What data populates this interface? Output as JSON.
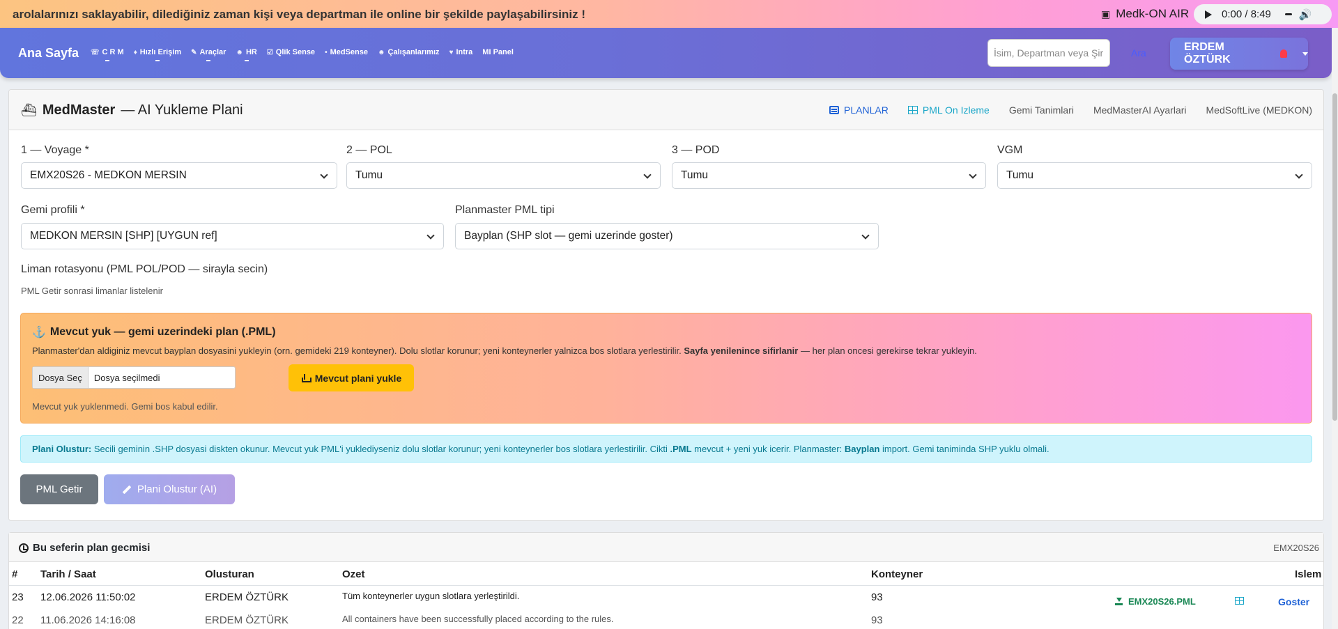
{
  "marquee": {
    "text": "arolalarınızı saklayabilir, dilediğiniz zaman kişi veya departman ile online bir şekilde paylaşabilirsiniz !"
  },
  "radio": {
    "label": "Medk-ON AIR",
    "time": "0:00 / 8:49"
  },
  "navbar": {
    "brand": "Ana Sayfa",
    "items": [
      {
        "label": "C R M",
        "icon": "crm-icon",
        "glyph": "☏"
      },
      {
        "label": "Hızlı Erişim",
        "icon": "rocket-icon",
        "glyph": "♦"
      },
      {
        "label": "Araçlar",
        "icon": "tools-icon",
        "glyph": "✎"
      },
      {
        "label": "HR",
        "icon": "people-icon",
        "glyph": "☻"
      },
      {
        "label": "Qlik Sense",
        "icon": "checkbox-icon",
        "glyph": "☑"
      },
      {
        "label": "MedSense",
        "icon": "pin-icon",
        "glyph": "•"
      },
      {
        "label": "Çalışanlarımız",
        "icon": "people-icon",
        "glyph": "☻"
      },
      {
        "label": "Intra",
        "icon": "handshake-icon",
        "glyph": "♥"
      },
      {
        "label": "MI Panel",
        "icon": "",
        "glyph": ""
      }
    ],
    "search_placeholder": "İsim, Departman veya Şirket",
    "search_button": "Ara",
    "user": "ERDEM ÖZTÜRK"
  },
  "card": {
    "title_bold": "MedMaster",
    "title_rest": "— AI Yukleme Plani",
    "tabs": [
      {
        "label": "PLANLAR",
        "state": "active"
      },
      {
        "label": "PML On Izleme",
        "state": "cyan"
      },
      {
        "label": "Gemi Tanimlari",
        "state": ""
      },
      {
        "label": "MedMasterAI Ayarlari",
        "state": ""
      },
      {
        "label": "MedSoftLive (MEDKON)",
        "state": ""
      }
    ],
    "voyage": {
      "label": "1 — Voyage *",
      "value": "EMX20S26 - MEDKON MERSIN"
    },
    "pol": {
      "label": "2 — POL",
      "value": "Tumu"
    },
    "pod": {
      "label": "3 — POD",
      "value": "Tumu"
    },
    "vgm": {
      "label": "VGM",
      "value": "Tumu"
    },
    "profile": {
      "label": "Gemi profili *",
      "value": "MEDKON MERSIN [SHP] [UYGUN ref]"
    },
    "pml_type": {
      "label": "Planmaster PML tipi",
      "value": "Bayplan (SHP slot — gemi uzerinde goster)"
    },
    "rotation": {
      "label": "Liman rotasyonu (PML POL/POD — sirayla secin)",
      "hint": "PML Getir sonrasi limanlar listelenir"
    },
    "upload": {
      "title": "Mevcut yuk — gemi uzerindeki plan (.PML)",
      "desc_pre": "Planmaster'dan aldiginiz mevcut bayplan dosyasini yukleyin (orn. gemideki 219 konteyner). Dolu slotlar korunur; yeni konteynerler yalnizca bos slotlara yerlestirilir. ",
      "desc_bold": "Sayfa yenilenince sifirlanir",
      "desc_post": " — her plan oncesi gerekirse tekrar yukleyin.",
      "file_button": "Dosya Seç",
      "file_name": "Dosya seçilmedi",
      "load_button": "Mevcut plani yukle",
      "status": "Mevcut yuk yuklenmedi. Gemi bos kabul edilir."
    },
    "info": {
      "b1": "Plani Olustur:",
      "t1": " Secili geminin .SHP dosyasi diskten okunur. Mevcut yuk PML'i yuklediyseniz dolu slotlar korunur; yeni konteynerler bos slotlara yerlestirilir. Cikti ",
      "b2": ".PML",
      "t2": " mevcut + yeni yuk icerir. Planmaster: ",
      "b3": "Bayplan",
      "t3": " import. Gemi taniminda SHP yuklu olmali."
    },
    "btn_getir": "PML Getir",
    "btn_olustur": "Plani Olustur (AI)"
  },
  "history": {
    "title": "Bu seferin plan gecmisi",
    "voyage": "EMX20S26",
    "headers": {
      "no": "#",
      "date": "Tarih / Saat",
      "creator": "Olusturan",
      "summary": "Ozet",
      "count": "Konteyner",
      "action": "Islem"
    },
    "rows": [
      {
        "no": "23",
        "date": "12.06.2026 11:50:02",
        "creator": "ERDEM ÖZTÜRK",
        "summary": "Tüm konteynerler uygun slotlara yerleştirildi.",
        "count": "93",
        "file": "EMX20S26.PML",
        "show": "Goster"
      },
      {
        "no": "22",
        "date": "11.06.2026 14:16:08",
        "creator": "ERDEM ÖZTÜRK",
        "summary": "All containers have been successfully placed according to the rules.",
        "count": "93"
      }
    ]
  }
}
